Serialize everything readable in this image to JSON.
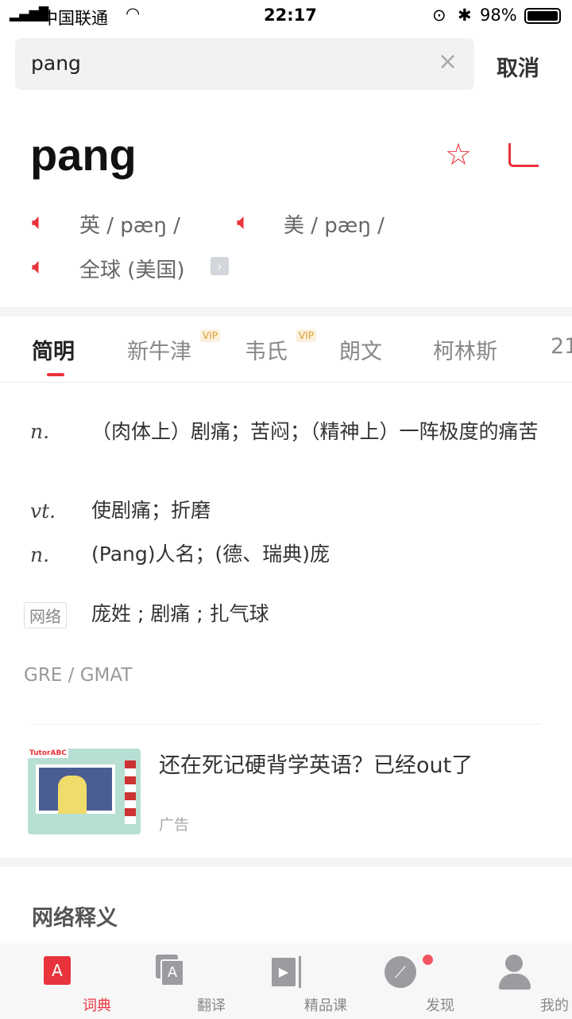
{
  "status": {
    "carrier": "中国联通",
    "time": "22:17",
    "battery": "98%"
  },
  "search": {
    "value": "pang",
    "cancel": "取消"
  },
  "entry": {
    "word": "pang",
    "uk": "英 / pæŋ /",
    "us": "美 / pæŋ /",
    "global": "全球 (美国)"
  },
  "tabs": [
    {
      "label": "简明",
      "active": true
    },
    {
      "label": "新牛津",
      "vip": "VIP"
    },
    {
      "label": "韦氏",
      "vip": "VIP"
    },
    {
      "label": "朗文"
    },
    {
      "label": "柯林斯"
    },
    {
      "label": "21"
    }
  ],
  "definitions": [
    {
      "pos": "n.",
      "text": "（肉体上）剧痛；苦闷；（精神上）一阵极度的痛苦"
    },
    {
      "pos": "vt.",
      "text": "使剧痛；折磨"
    },
    {
      "pos": "n.",
      "text": "(Pang)人名；(德、瑞典)庞"
    }
  ],
  "web": {
    "tag": "网络",
    "text": "庞姓 ; 剧痛 ; 扎气球"
  },
  "exam": "GRE / GMAT",
  "ad": {
    "title": "还在死记硬背学英语？已经out了",
    "label": "广告",
    "brand": "TutorABC"
  },
  "section_title": "网络释义",
  "nav": [
    {
      "label": "词典",
      "active": true
    },
    {
      "label": "翻译"
    },
    {
      "label": "精品课"
    },
    {
      "label": "发现",
      "badge": true
    },
    {
      "label": "我的"
    }
  ],
  "colors": {
    "accent": "#e8333c",
    "vip": "#d9a036"
  }
}
